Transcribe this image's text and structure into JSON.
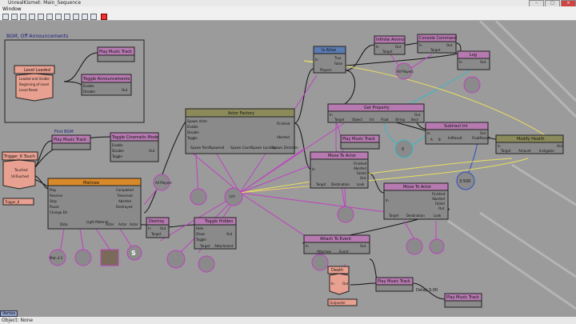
{
  "window": {
    "title": "UnrealKismet: Main_Sequence",
    "menu": [
      "Window"
    ]
  },
  "status": {
    "text": "Object: None"
  },
  "canvas": {
    "comment": "BGM, Off Announcements",
    "nodes": {
      "level_loaded": {
        "title": "Level Loaded",
        "outputs": [
          "Loaded and Visible",
          "Beginning of Level",
          "Level Reset"
        ]
      },
      "play_music_track_a": {
        "title": "Play Music Track"
      },
      "toggle_announcements": {
        "title": "Toggle Announcements",
        "inputs": [
          "Enable",
          "Disable"
        ],
        "out": "Out"
      },
      "first_bgm": {
        "label": "First BGM",
        "title": "Play Music Track"
      },
      "toggle_cinematic": {
        "title": "Toggle Cinematic Mode",
        "inputs": [
          "Enable",
          "Disable",
          "Toggle"
        ],
        "out": "Out"
      },
      "trigger_touch": {
        "title": "Trigger_6 Touch",
        "outputs": [
          "Touched",
          "UnTouched"
        ],
        "footer": "Trigger_6"
      },
      "matinee": {
        "title": "Matinee",
        "inputs": [
          "Play",
          "Reverse",
          "Stop",
          "Pause",
          "Change Dir"
        ],
        "outputs": [
          "Completed",
          "Reversed",
          "Aborted",
          "Destroyed"
        ],
        "vars": [
          "Data",
          "Light Material",
          "Actor",
          "Actor",
          "Actor"
        ]
      },
      "actor_factory": {
        "title": "Actor Factory",
        "inputs": [
          "Spawn Actor",
          "Enable",
          "Disable",
          "Toggle"
        ],
        "outputs": [
          "Finished",
          "Aborted"
        ],
        "vars": [
          "Spawn Point",
          "Spawned",
          "Spawn Count",
          "Spawn Location",
          "Spawn Direction"
        ]
      },
      "destroy": {
        "title": "Destroy",
        "in": "In",
        "out": "Out",
        "var": "Target"
      },
      "toggle_hidden": {
        "title": "Toggle Hidden",
        "inputs": [
          "Hide",
          "Show",
          "Toggle"
        ],
        "out": "Out",
        "vars": [
          "Target",
          "Attachment"
        ]
      },
      "is_alive": {
        "title": "Is Alive",
        "in": "In",
        "outputs": [
          "True",
          "False"
        ],
        "var": "Players"
      },
      "infinite_ammo": {
        "title": "Infinite Ammo",
        "in": "In",
        "out": "Out",
        "var": "Target"
      },
      "console_command": {
        "title": "Console Command",
        "in": "In",
        "out": "Out",
        "var": "Target"
      },
      "log": {
        "title": "Log",
        "in": "In",
        "out": "Out"
      },
      "get_property": {
        "title": "Get Property",
        "in": "In",
        "out": "Out",
        "vars": [
          "Target",
          "Object",
          "Int",
          "Float",
          "String",
          "Bool"
        ]
      },
      "subtract_int": {
        "title": "Subtract Int",
        "in": "In",
        "out": "Out",
        "vars": [
          "A",
          "B",
          "IntResult",
          "FloatResult"
        ]
      },
      "modify_health": {
        "title": "Modify Health",
        "in": "In",
        "out": "Out",
        "vars": [
          "Target",
          "Amount",
          "Instigator"
        ]
      },
      "play_music_track_b": {
        "title": "Play Music Track"
      },
      "move_to_actor_a": {
        "title": "Move To Actor",
        "in": "In",
        "outputs": [
          "Finished",
          "Aborted",
          "Failed",
          "Out"
        ],
        "vars": [
          "Target",
          "Destination",
          "Look"
        ]
      },
      "move_to_actor_b": {
        "title": "Move To Actor",
        "in": "In",
        "outputs": [
          "Finished",
          "Aborted",
          "Failed",
          "Out"
        ],
        "vars": [
          "Target",
          "Destination",
          "Look"
        ]
      },
      "attach_to_event": {
        "title": "Attach To Event",
        "in": "In",
        "out": "Out",
        "vars": [
          "Attachee",
          "Event"
        ]
      },
      "death": {
        "title": "Death",
        "in": "In",
        "out": "Out",
        "footer": "Outposter"
      },
      "play_music_track_c": {
        "title": "Play Music Track",
        "delay": "Delay 3.00"
      },
      "play_music_track_d": {
        "title": "Play Music Track"
      }
    },
    "vars": {
      "all_players_a": "All Players",
      "all_players_b": "All Players",
      "v_0": "0",
      "v_3500": "3.500",
      "q_3": "???",
      "matinee_data": "Mat..d 2",
      "s_icon": "S"
    },
    "side_label": "Vertex"
  }
}
